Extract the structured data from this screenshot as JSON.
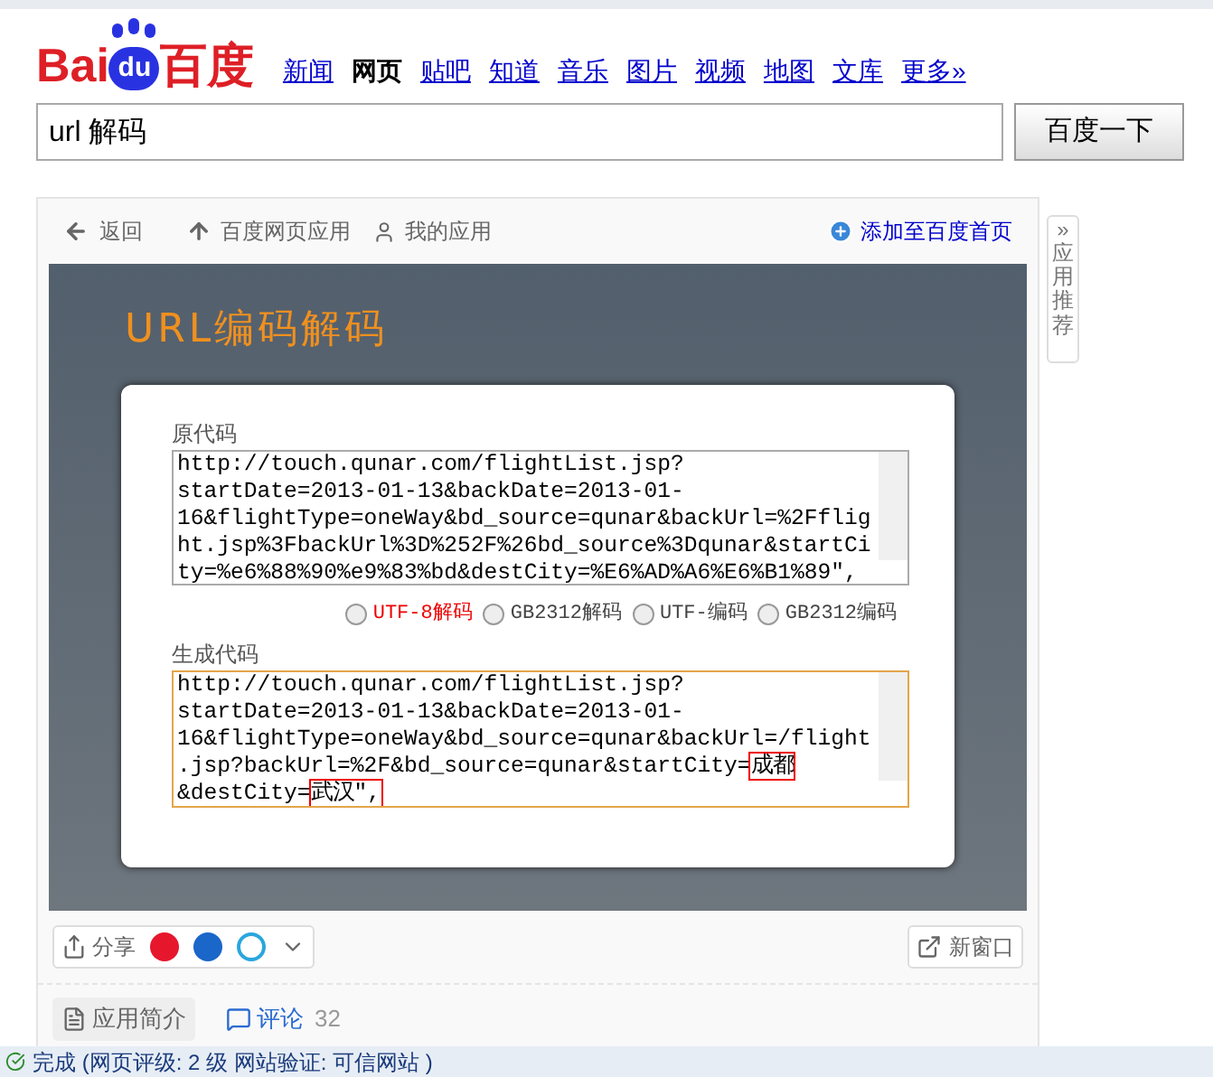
{
  "logo": {
    "text_left": "Bai",
    "text_paw": "du",
    "text_right": "百度"
  },
  "nav": [
    {
      "label": "新闻",
      "selected": false
    },
    {
      "label": "网页",
      "selected": true
    },
    {
      "label": "贴吧",
      "selected": false
    },
    {
      "label": "知道",
      "selected": false
    },
    {
      "label": "音乐",
      "selected": false
    },
    {
      "label": "图片",
      "selected": false
    },
    {
      "label": "视频",
      "selected": false
    },
    {
      "label": "地图",
      "selected": false
    },
    {
      "label": "文库",
      "selected": false
    },
    {
      "label": "更多»",
      "selected": false
    }
  ],
  "search": {
    "value": "url 解码",
    "button": "百度一下"
  },
  "app_toolbar": {
    "back": "返回",
    "home": "百度网页应用",
    "mine": "我的应用",
    "add": "添加至百度首页"
  },
  "side_tab": {
    "arrow": "»",
    "label": "应用推荐"
  },
  "app": {
    "title": "URL编码解码",
    "source_label": "原代码",
    "source": "http://touch.qunar.com/flightList.jsp?startDate=2013-01-13&backDate=2013-01-16&flightType=oneWay&bd_source=qunar&backUrl=%2Fflight.jsp%3FbackUrl%3D%252F%26bd_source%3Dqunar&startCity=%e6%88%90%e9%83%bd&destCity=%E6%AD%A6%E6%B1%89\",",
    "options": [
      {
        "label": "UTF-8解码",
        "selected": false,
        "emphasized": true
      },
      {
        "label": "GB2312解码",
        "selected": false,
        "emphasized": false
      },
      {
        "label": "UTF-编码",
        "selected": false,
        "emphasized": false
      },
      {
        "label": "GB2312编码",
        "selected": false,
        "emphasized": false
      }
    ],
    "output_label": "生成代码",
    "output": [
      {
        "text": "http://touch.qunar.com/flightList.jsp?startDate=2013-01-13&backDate=2013-01-16&flightType=oneWay&bd_source=qunar&backUrl=/flight.jsp?backUrl=%2F&bd_source=qunar&startCity=",
        "highlighted": false
      },
      {
        "text": "成都",
        "highlighted": true
      },
      {
        "text": "&destCity=",
        "highlighted": false
      },
      {
        "text": "武汉\",",
        "highlighted": true
      }
    ]
  },
  "share_bar": {
    "share": "分享",
    "new_window": "新窗口"
  },
  "tabs": [
    {
      "label": "应用简介",
      "selected": true
    },
    {
      "label": "评论",
      "selected": false,
      "count": "32"
    }
  ],
  "status_bar": "完成 (网页评级: 2 级 网站验证: 可信网站 )"
}
